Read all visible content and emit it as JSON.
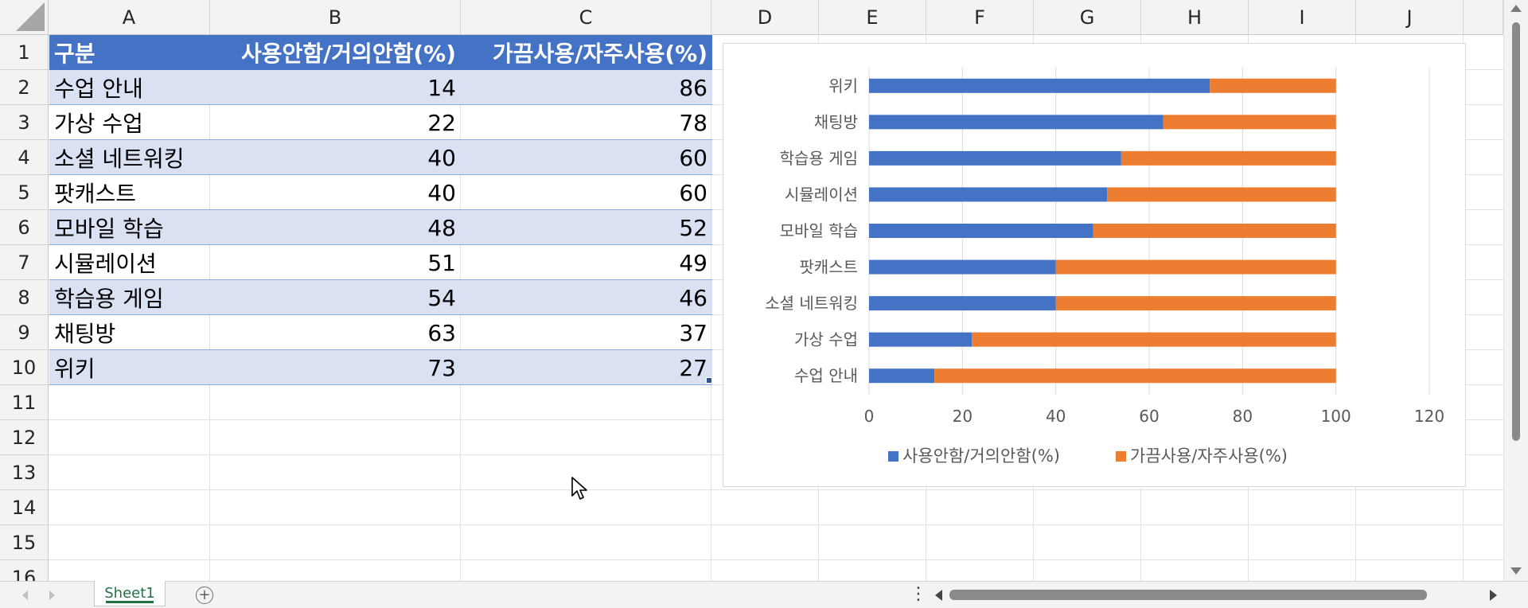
{
  "spreadsheet": {
    "column_headers": [
      "A",
      "B",
      "C",
      "D",
      "E",
      "F",
      "G",
      "H",
      "I",
      "J"
    ],
    "row_headers": [
      "1",
      "2",
      "3",
      "4",
      "5",
      "6",
      "7",
      "8",
      "9",
      "10",
      "11",
      "12",
      "13",
      "14",
      "15",
      "16"
    ],
    "table": {
      "headers": [
        "구분",
        "사용안함/거의안함(%)",
        "가끔사용/자주사용(%)"
      ],
      "rows": [
        [
          "수업 안내",
          "14",
          "86"
        ],
        [
          "가상 수업",
          "22",
          "78"
        ],
        [
          "소셜 네트워킹",
          "40",
          "60"
        ],
        [
          "팟캐스트",
          "40",
          "60"
        ],
        [
          "모바일 학습",
          "48",
          "52"
        ],
        [
          "시뮬레이션",
          "51",
          "49"
        ],
        [
          "학습용 게임",
          "54",
          "46"
        ],
        [
          "채팅방",
          "63",
          "37"
        ],
        [
          "위키",
          "73",
          "27"
        ]
      ]
    }
  },
  "chart_data": {
    "type": "bar",
    "orientation": "horizontal",
    "stacked": true,
    "categories": [
      "수업 안내",
      "가상 수업",
      "소셜 네트워킹",
      "팟캐스트",
      "모바일 학습",
      "시뮬레이션",
      "학습용 게임",
      "채팅방",
      "위키"
    ],
    "series": [
      {
        "name": "사용안함/거의안함(%)",
        "color": "#4472c4",
        "values": [
          14,
          22,
          40,
          40,
          48,
          51,
          54,
          63,
          73
        ]
      },
      {
        "name": "가끔사용/자주사용(%)",
        "color": "#ed7d31",
        "values": [
          86,
          78,
          60,
          60,
          52,
          49,
          46,
          37,
          27
        ]
      }
    ],
    "xlim": [
      0,
      120
    ],
    "xticks": [
      "0",
      "20",
      "40",
      "60",
      "80",
      "100",
      "120"
    ],
    "grid": true,
    "legend": "bottom"
  },
  "sheet_tabs": [
    {
      "label": "Sheet1",
      "active": true
    }
  ],
  "icons": {
    "add_sheet": "plus-circle-icon",
    "cursor": "mouse-pointer-icon",
    "more": "vertical-ellipsis-icon"
  },
  "bottom": {
    "add_sheet_symbol": "+",
    "more_symbol": "⋮"
  }
}
